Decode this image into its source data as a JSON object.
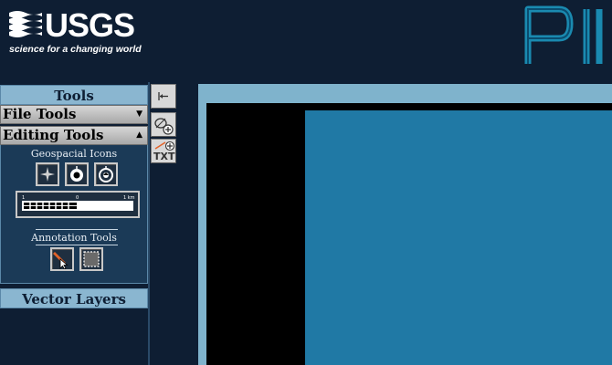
{
  "header": {
    "org_name": "USGS",
    "tagline": "science for a changing world"
  },
  "left_panel": {
    "tools_title": "Tools",
    "file_tools": {
      "label": "File Tools",
      "arrow": "▼"
    },
    "editing_tools": {
      "label": "Editing Tools",
      "arrow": "▲",
      "geospatial_label": "Geospacial Icons",
      "geospatial_icons": [
        "north-arrow-icon",
        "point-marker-icon",
        "compass-rose-icon"
      ],
      "scalebar": {
        "start": "1",
        "mid": "0",
        "end": "1 km"
      },
      "annotation_label": "Annotation Tools",
      "annotation_icons": [
        "pencil-draw-icon",
        "selection-box-icon"
      ]
    },
    "vector_layers_title": "Vector Layers"
  },
  "toolbar": {
    "collapse_glyph": "⇤",
    "text_tool_label": "TXT"
  },
  "colors": {
    "page_bg": "#0e1e33",
    "panel_header": "#8ab6d0",
    "editing_bg": "#1b3a57",
    "map_frame": "#7fb3cc",
    "map_water": "#2079a5",
    "logo_cyan": "#1a8ab0"
  }
}
